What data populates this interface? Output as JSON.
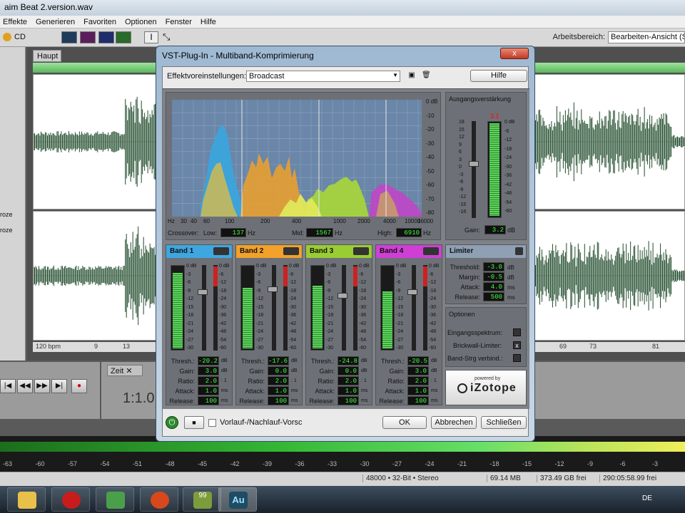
{
  "app": {
    "title": "aim Beat 2.version.wav",
    "menu": [
      "Effekte",
      "Generieren",
      "Favoriten",
      "Optionen",
      "Fenster",
      "Hilfe"
    ],
    "cd_label": "CD",
    "workspace_label": "Arbeitsbereich:",
    "workspace_value": "Bearbeiten-Ansicht (S",
    "main_tab": "Haupt",
    "left_items": [
      "roze",
      "roze"
    ],
    "ruler": {
      "bpm": "120 bpm",
      "ticks": [
        "9",
        "13",
        "69",
        "73",
        "81"
      ]
    },
    "zeit_tab": "Zeit",
    "time_display": "1:1.0",
    "level_scale": [
      "-63",
      "-60",
      "-57",
      "-54",
      "-51",
      "-48",
      "-45",
      "-42",
      "-39",
      "-36",
      "-33",
      "-30",
      "-27",
      "-24",
      "-21",
      "-18",
      "-15",
      "-12",
      "-9",
      "-6",
      "-3"
    ],
    "status": {
      "format": "48000 • 32-Bit • Stereo",
      "size": "69.14 MB",
      "free": "373.49 GB frei",
      "time_free": "290:05:58.99 frei"
    },
    "taskbar": {
      "lang": "DE",
      "au_label": "Au",
      "badge": "99"
    }
  },
  "dialog": {
    "title": "VST-Plug-In - Multiband-Komprimierung",
    "close_label": "x",
    "preset_label": "Effektvoreinstellungen:",
    "preset_value": "Broadcast",
    "help_button": "Hilfe",
    "ok_button": "OK",
    "cancel_button": "Abbrechen",
    "close_button": "Schließen",
    "preroll_label": "Vorlauf-/Nachlauf-Vorsc",
    "power_icon": "power-icon",
    "stop_icon": "stop-icon"
  },
  "analyzer": {
    "db_scale": [
      "0 dB",
      "-10",
      "-20",
      "-30",
      "-40",
      "-50",
      "-60",
      "-70",
      "-80"
    ],
    "freq_scale": [
      "Hz",
      "30",
      "40",
      "60",
      "100",
      "200",
      "400",
      "1000",
      "2000",
      "4000",
      "10000",
      "16000"
    ],
    "crossover_label": "Crossover:",
    "low_label": "Low:",
    "low_value": "137",
    "low_unit": "Hz",
    "mid_label": "Mid:",
    "mid_value": "1567",
    "mid_unit": "Hz",
    "high_label": "High:",
    "high_value": "6910",
    "high_unit": "Hz"
  },
  "output_gain": {
    "title": "Ausgangsverstärkung",
    "peak": "3.1",
    "slider_scale": [
      "18",
      "15",
      "12",
      "9",
      "6",
      "3",
      "0",
      "-3",
      "-6",
      "-9",
      "-12",
      "-15",
      "-18"
    ],
    "meter_scale": [
      "0 dB",
      "-6",
      "-12",
      "-18",
      "-24",
      "-30",
      "-36",
      "-42",
      "-48",
      "-54",
      "-60"
    ],
    "gain_label": "Gain:",
    "gain_value": "3.2",
    "gain_unit": "dB"
  },
  "bands": [
    {
      "name": "Band 1",
      "color": "#3fa7e0",
      "thresh": "-20.2",
      "gain": "3.0",
      "ratio": "2.0",
      "attack": "1.0",
      "release": "100",
      "meter_level": 0.9,
      "thresh_level": 0.3
    },
    {
      "name": "Band 2",
      "color": "#f2a12a",
      "thresh": "-17.6",
      "gain": "0.0",
      "ratio": "2.0",
      "attack": "1.0",
      "release": "100",
      "meter_level": 0.72,
      "thresh_level": 0.27
    },
    {
      "name": "Band 3",
      "color": "#9acd32",
      "thresh": "-24.8",
      "gain": "0.0",
      "ratio": "2.0",
      "attack": "1.0",
      "release": "100",
      "meter_level": 0.75,
      "thresh_level": 0.35
    },
    {
      "name": "Band 4",
      "color": "#cf3fd6",
      "thresh": "-20.5",
      "gain": "3.0",
      "ratio": "2.0",
      "attack": "1.0",
      "release": "100",
      "meter_level": 0.68,
      "thresh_level": 0.3
    }
  ],
  "band_labels": {
    "thresh": "Thresh.:",
    "gain": "Gain:",
    "ratio": "Ratio:",
    "attack": "Attack:",
    "release": "Release:",
    "db": "dB",
    "ratio_unit": ": 1",
    "ms": "ms"
  },
  "band_meter_scale": [
    "0 dB",
    "-3",
    "-6",
    "-9",
    "-12",
    "-15",
    "-18",
    "-21",
    "-24",
    "-27",
    "-30"
  ],
  "band_slider_scale": [
    "0 dB",
    "-6",
    "-12",
    "-18",
    "-24",
    "-30",
    "-36",
    "-42",
    "-48",
    "-54",
    "-60"
  ],
  "limiter": {
    "title": "Limiter",
    "threshold_label": "Threshold:",
    "threshold_value": "-3.0",
    "threshold_unit": "dB",
    "margin_label": "Margin:",
    "margin_value": "-0.5",
    "margin_unit": "dB",
    "attack_label": "Attack:",
    "attack_value": "4.0",
    "attack_unit": "ms",
    "release_label": "Release:",
    "release_value": "500",
    "release_unit": "ms"
  },
  "options": {
    "title": "Optionen",
    "input_spectrum": "Eingangsspektrum:",
    "brickwall": "Brickwall-Limiter:",
    "band_link": "Band-Strg verbind.:",
    "brickwall_checked": "x"
  },
  "brand": {
    "powered_by": "powered by",
    "name": "iZotope"
  },
  "colors": {
    "accent_green": "#33b533",
    "dialog_frame": "#9fb9d2"
  }
}
